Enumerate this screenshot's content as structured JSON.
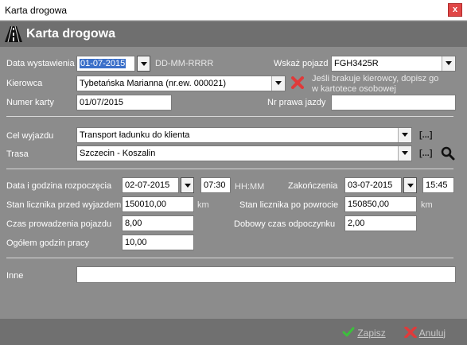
{
  "window": {
    "title": "Karta drogowa",
    "close_label": "x"
  },
  "header": {
    "title": "Karta drogowa"
  },
  "form": {
    "data_wystawienia": {
      "label": "Data wystawienia",
      "value": "01-07-2015",
      "format_hint": "DD-MM-RRRR"
    },
    "pojazd": {
      "label": "Wskaż pojazd",
      "value": "FGH3425R"
    },
    "kierowca": {
      "label": "Kierowca",
      "value": "Tybetańska Marianna (nr.ew. 000021)",
      "hint_line1": "Jeśli brakuje kierowcy, dopisz go",
      "hint_line2": "w kartotece osobowej"
    },
    "numer_karty": {
      "label": "Numer karty",
      "value": "01/07/2015"
    },
    "nr_prawa_jazdy": {
      "label": "Nr prawa jazdy",
      "value": ""
    },
    "cel_wyjazdu": {
      "label": "Cel wyjazdu",
      "value": "Transport ładunku do klienta",
      "more": "[...]"
    },
    "trasa": {
      "label": "Trasa",
      "value": "Szczecin - Koszalin",
      "more": "[...]"
    },
    "rozpoczecie": {
      "label": "Data i godzina rozpoczęcia",
      "date": "02-07-2015",
      "time": "07:30",
      "time_hint": "HH:MM"
    },
    "zakonczenie": {
      "label": "Zakończenia",
      "date": "03-07-2015",
      "time": "15:45"
    },
    "licznik_przed": {
      "label": "Stan licznika przed wyjazdem",
      "value": "150010,00",
      "unit": "km"
    },
    "licznik_po": {
      "label": "Stan licznika po powrocie",
      "value": "150850,00",
      "unit": "km"
    },
    "czas_prowadzenia": {
      "label": "Czas prowadzenia pojazdu",
      "value": "8,00"
    },
    "odpoczynek": {
      "label": "Dobowy czas odpoczynku",
      "value": "2,00"
    },
    "godziny_pracy": {
      "label": "Ogółem godzin pracy",
      "value": "10,00"
    },
    "inne": {
      "label": "Inne",
      "value": ""
    }
  },
  "footer": {
    "save_label": "Zapisz",
    "cancel_label": "Anuluj"
  },
  "colors": {
    "header_bg": "#6f6f6f",
    "body_bg": "#8c8c8c",
    "save_check": "#3cbf3c",
    "cancel_x": "#e03a3a"
  }
}
